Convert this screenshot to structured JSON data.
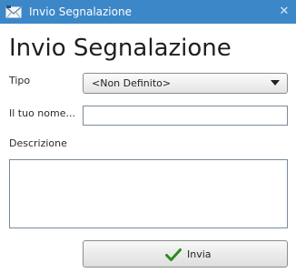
{
  "window": {
    "title": "Invio Segnalazione",
    "close_glyph": "✕",
    "accent_color": "#3b87c8"
  },
  "form": {
    "heading": "Invio Segnalazione",
    "tipo_label": "Tipo",
    "tipo_selected": "<Non Definito>",
    "name_label": "Il tuo nome...",
    "name_value": "",
    "description_label": "Descrizione",
    "description_value": "",
    "send_label": "Invia"
  },
  "icons": {
    "app": "envelope-icon",
    "send": "checkmark-icon",
    "close": "close-icon",
    "dropdown": "chevron-down-icon"
  }
}
